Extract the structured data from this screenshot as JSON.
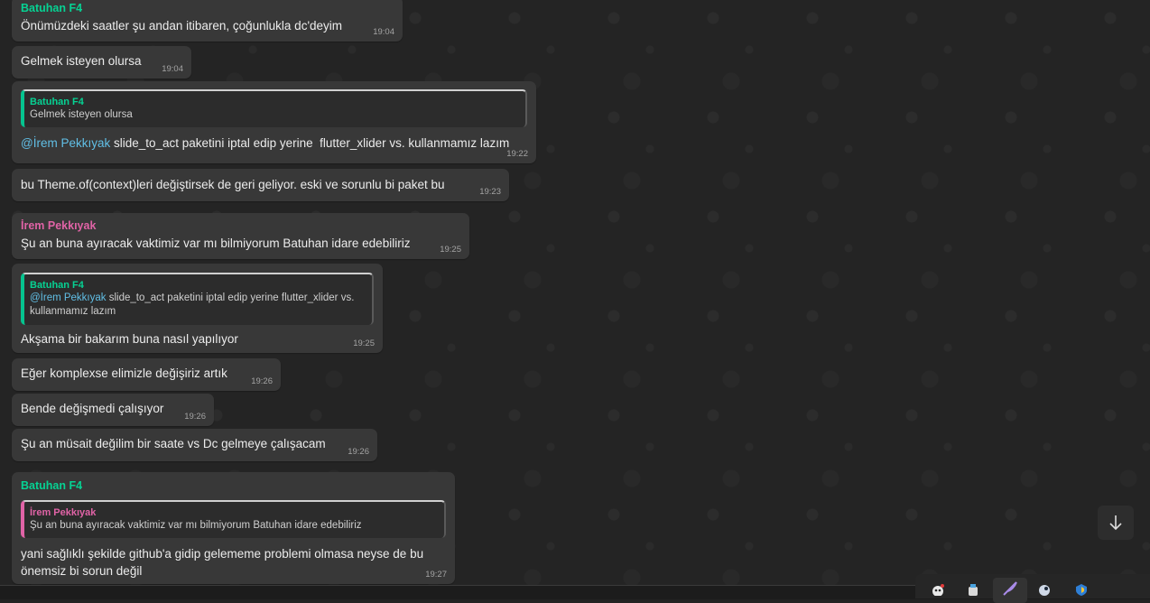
{
  "messages": [
    {
      "sender": "Batuhan F4",
      "text": "Önümüzdeki saatler şu andan itibaren, çoğunlukla dc'deyim",
      "time": "19:04"
    },
    {
      "text": "Gelmek isteyen olursa",
      "time": "19:04"
    },
    {
      "quote": {
        "sender": "Batuhan F4",
        "text": "Gelmek isteyen olursa"
      },
      "mention": "@İrem Pekkıyak",
      "text": " slide_to_act paketini iptal edip yerine  flutter_xlider vs. kullanmamız lazım",
      "time": "19:22"
    },
    {
      "text": "bu Theme.of(context)leri değiştirsek de geri geliyor. eski ve sorunlu bi paket bu",
      "time": "19:23"
    },
    {
      "sender": "İrem Pekkıyak",
      "text": "Şu an buna ayıracak vaktimiz var mı bilmiyorum Batuhan idare edebiliriz",
      "time": "19:25"
    },
    {
      "quote": {
        "sender": "Batuhan F4",
        "mention": "@İrem Pekkıyak",
        "text": " slide_to_act paketini iptal edip yerine  flutter_xlider vs. kullanmamız lazım"
      },
      "text": "Akşama bir bakarım buna nasıl yapılıyor",
      "time": "19:25"
    },
    {
      "text": "Eğer komplexse elimizle değişiriz artık",
      "time": "19:26"
    },
    {
      "text": "Bende değişmedi çalışıyor",
      "time": "19:26"
    },
    {
      "text": "Şu an müsait değilim bir saate vs Dc gelmeye çalışacam",
      "time": "19:26"
    },
    {
      "sender": "Batuhan F4",
      "quote": {
        "sender": "İrem Pekkıyak",
        "text": "Şu an buna ayıracak vaktimiz var mı bilmiyorum Batuhan idare edebiliriz"
      },
      "text": "yani sağlıklı şekilde github'a gidip gelememe problemi olmasa neyse de bu önemsiz bi sorun değil",
      "time": "19:27"
    }
  ],
  "icons": {
    "scroll_down": "arrow-down-icon",
    "tray": [
      "discord-icon",
      "hub-icon",
      "feather-icon",
      "steam-icon",
      "shield-icon"
    ]
  },
  "colors": {
    "background": "#242424",
    "bubble": "#383838",
    "sender_green": "#06d293",
    "sender_pink": "#e063a6",
    "mention": "#61bfe6"
  }
}
